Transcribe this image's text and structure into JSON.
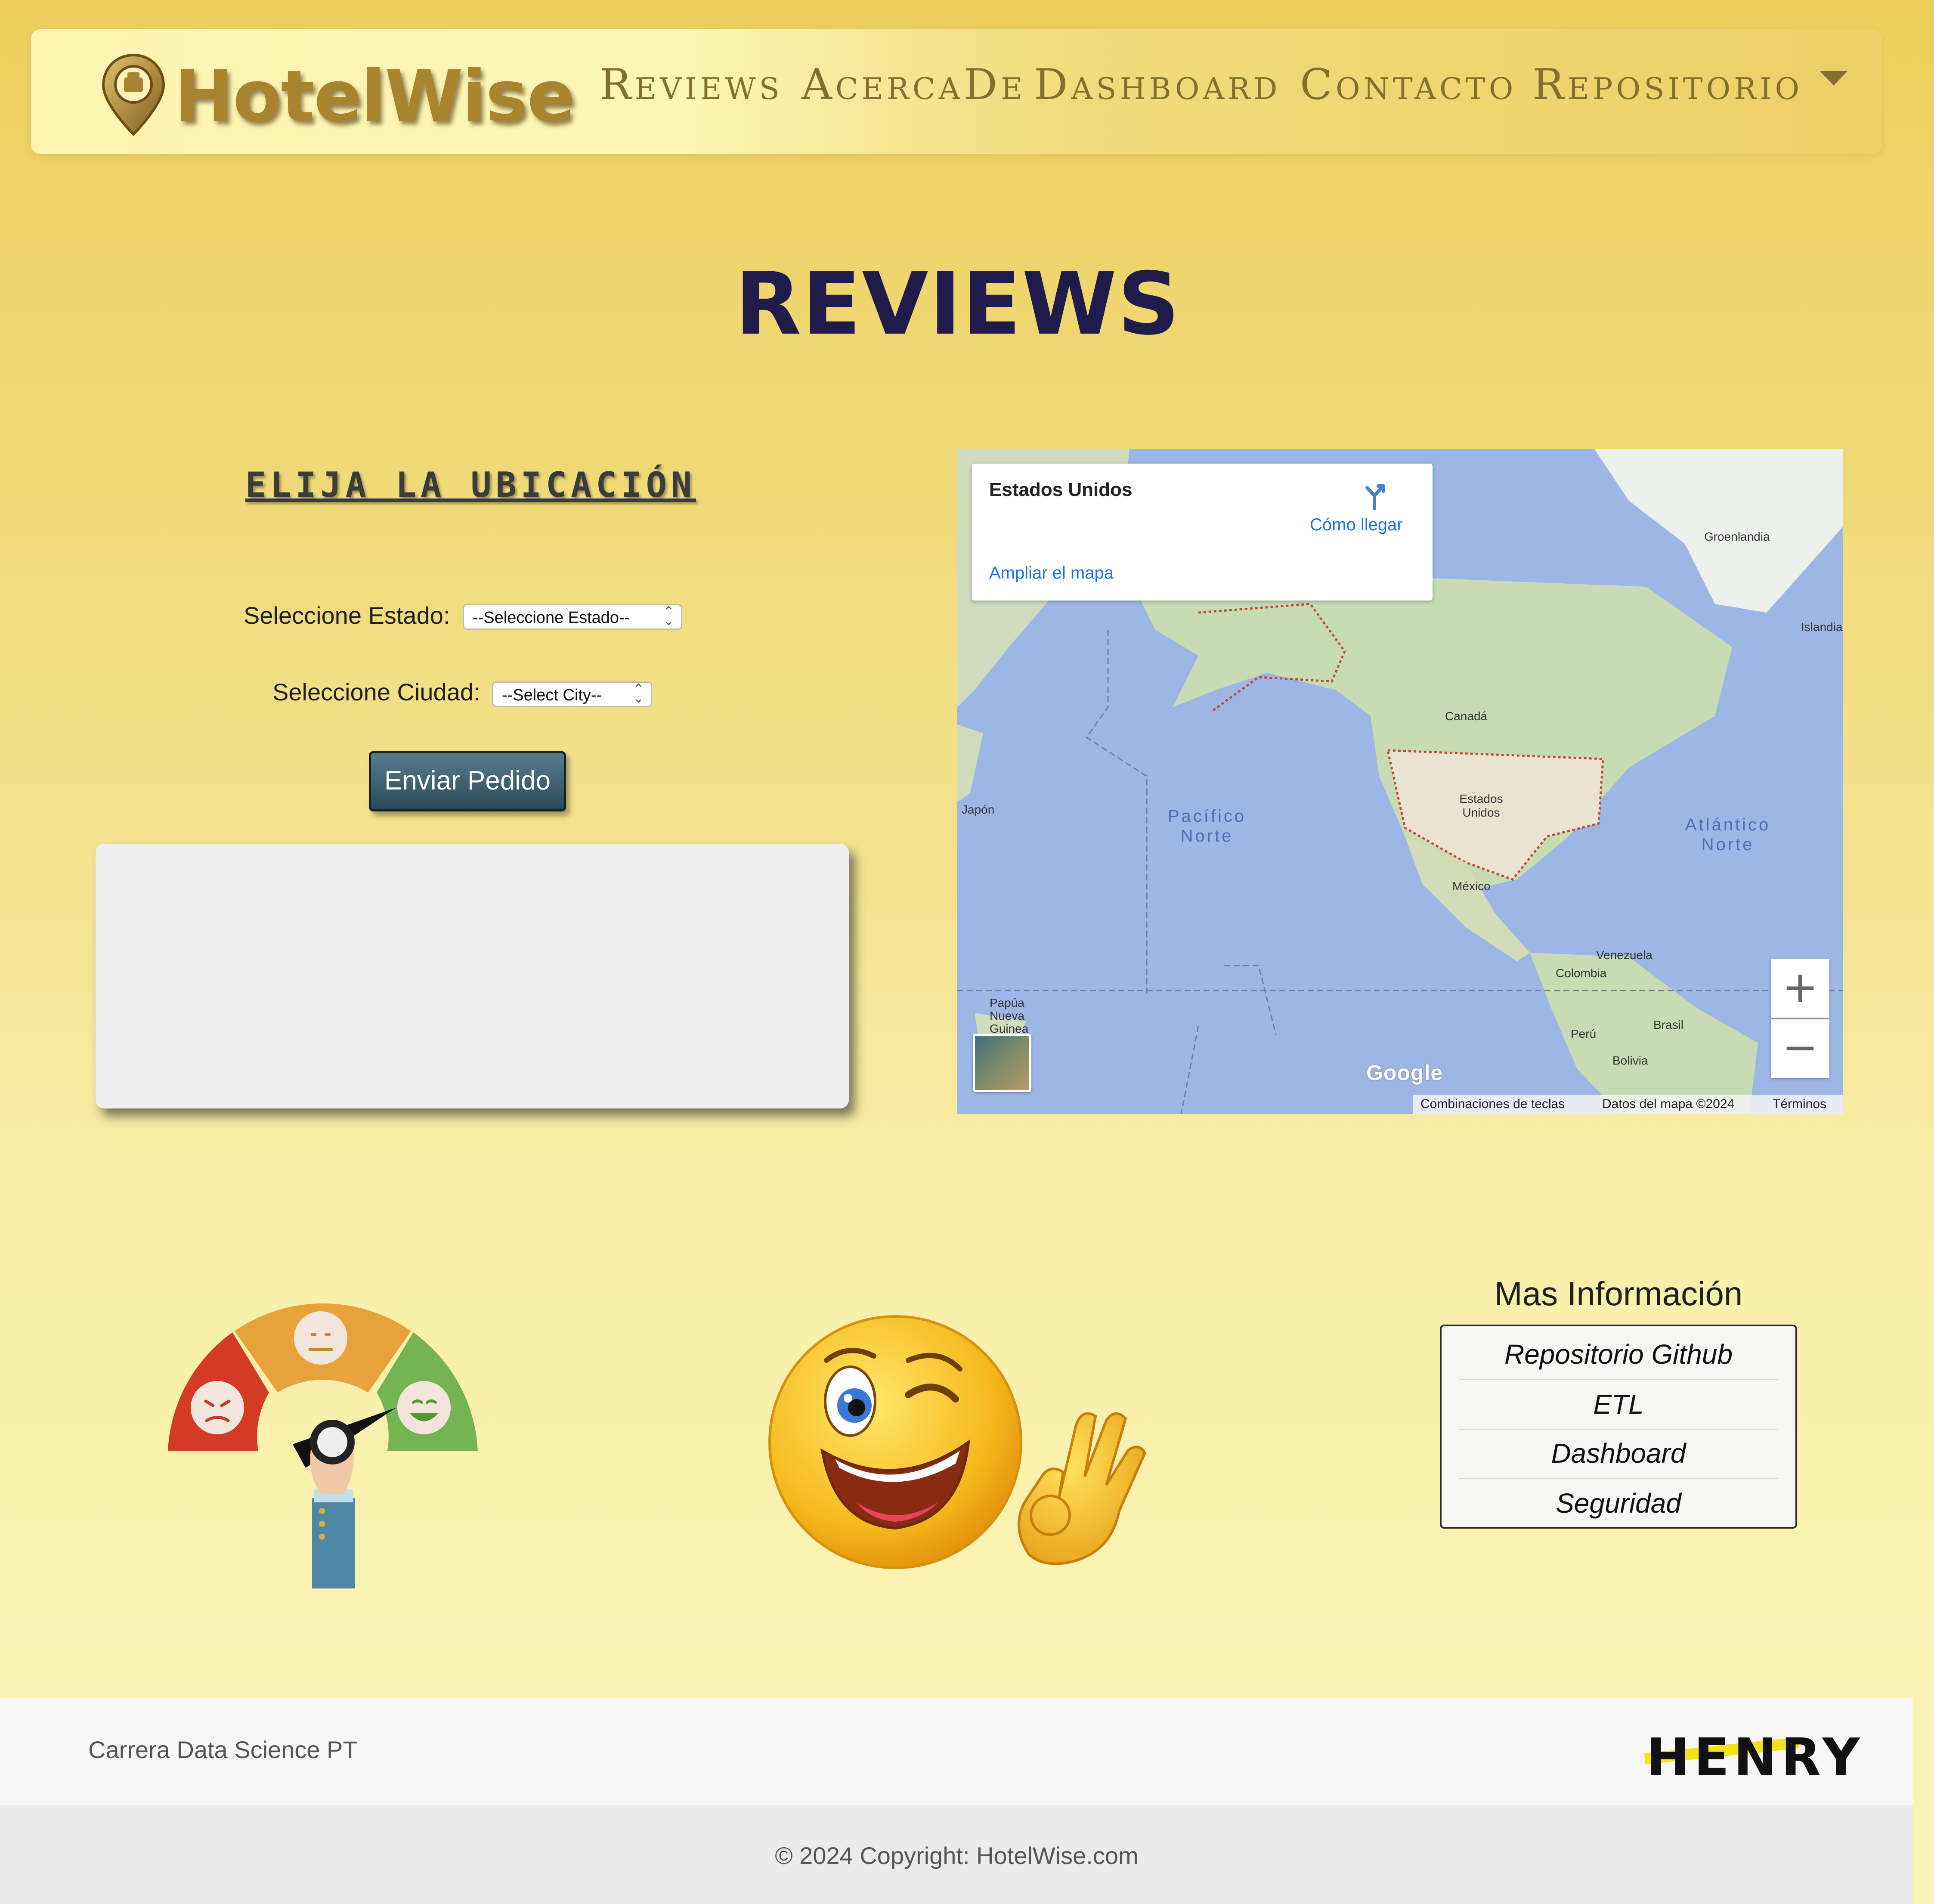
{
  "brand": {
    "name": "HotelWise"
  },
  "nav": {
    "items": [
      {
        "label": "Reviews"
      },
      {
        "label": "AcercaDe"
      },
      {
        "label": "Dashboard"
      },
      {
        "label": "Contacto"
      },
      {
        "label": "Repositorio"
      }
    ]
  },
  "page": {
    "title": "REVIEWS"
  },
  "location_form": {
    "heading": "ELIJA LA UBICACIÓN",
    "state_label": "Seleccione Estado:",
    "state_selected": "--Seleccione Estado--",
    "city_label": "Seleccione Ciudad:",
    "city_selected": "--Select City--",
    "submit_label": "Enviar Pedido"
  },
  "map": {
    "card_title": "Estados Unidos",
    "directions_label": "Cómo llegar",
    "enlarge_label": "Ampliar el mapa",
    "place_labels": [
      "Groenlandia",
      "Islandia",
      "Canadá",
      "Estados Unidos",
      "México",
      "Japón",
      "Venezuela",
      "Colombia",
      "Perú",
      "Brasil",
      "Bolivia",
      "Papúa Nueva Guinea"
    ],
    "ocean_labels": [
      "Pacífico Norte",
      "Atlántico Norte"
    ],
    "zoom_in": "+",
    "zoom_out": "−",
    "google": "Google",
    "footer": {
      "shortcuts": "Combinaciones de teclas",
      "data": "Datos del mapa ©2024",
      "terms": "Términos"
    }
  },
  "more_info": {
    "title": "Mas Información",
    "links": [
      {
        "label": "Repositorio Github"
      },
      {
        "label": "ETL"
      },
      {
        "label": "Dashboard"
      },
      {
        "label": "Seguridad"
      }
    ]
  },
  "footer": {
    "program": "Carrera Data Science PT",
    "partner_logo": "HENRY",
    "copyright": "© 2024 Copyright: HotelWise.com"
  },
  "colors": {
    "nav_text": "#83702e",
    "title": "#1f1c4c",
    "button": "#2b4a59",
    "link_blue": "#1a73e8"
  }
}
